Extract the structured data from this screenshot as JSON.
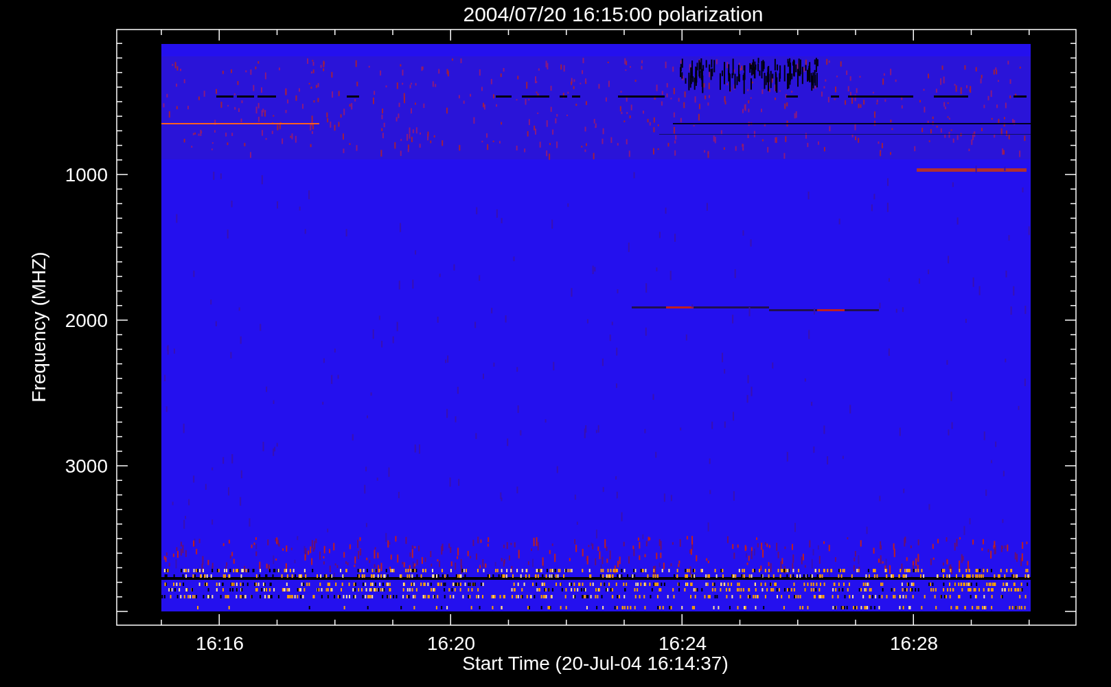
{
  "title": "2004/07/20 16:15:00 polarization",
  "y_axis": {
    "label": "Frequency (MHZ)",
    "ticks": [
      {
        "label": "1000"
      },
      {
        "label": "2000"
      },
      {
        "label": "3000"
      }
    ]
  },
  "x_axis": {
    "label": "Start Time (20-Jul-04 16:14:37)",
    "ticks": [
      {
        "label": "16:16"
      },
      {
        "label": "16:20"
      },
      {
        "label": "16:24"
      },
      {
        "label": "16:28"
      }
    ]
  }
}
